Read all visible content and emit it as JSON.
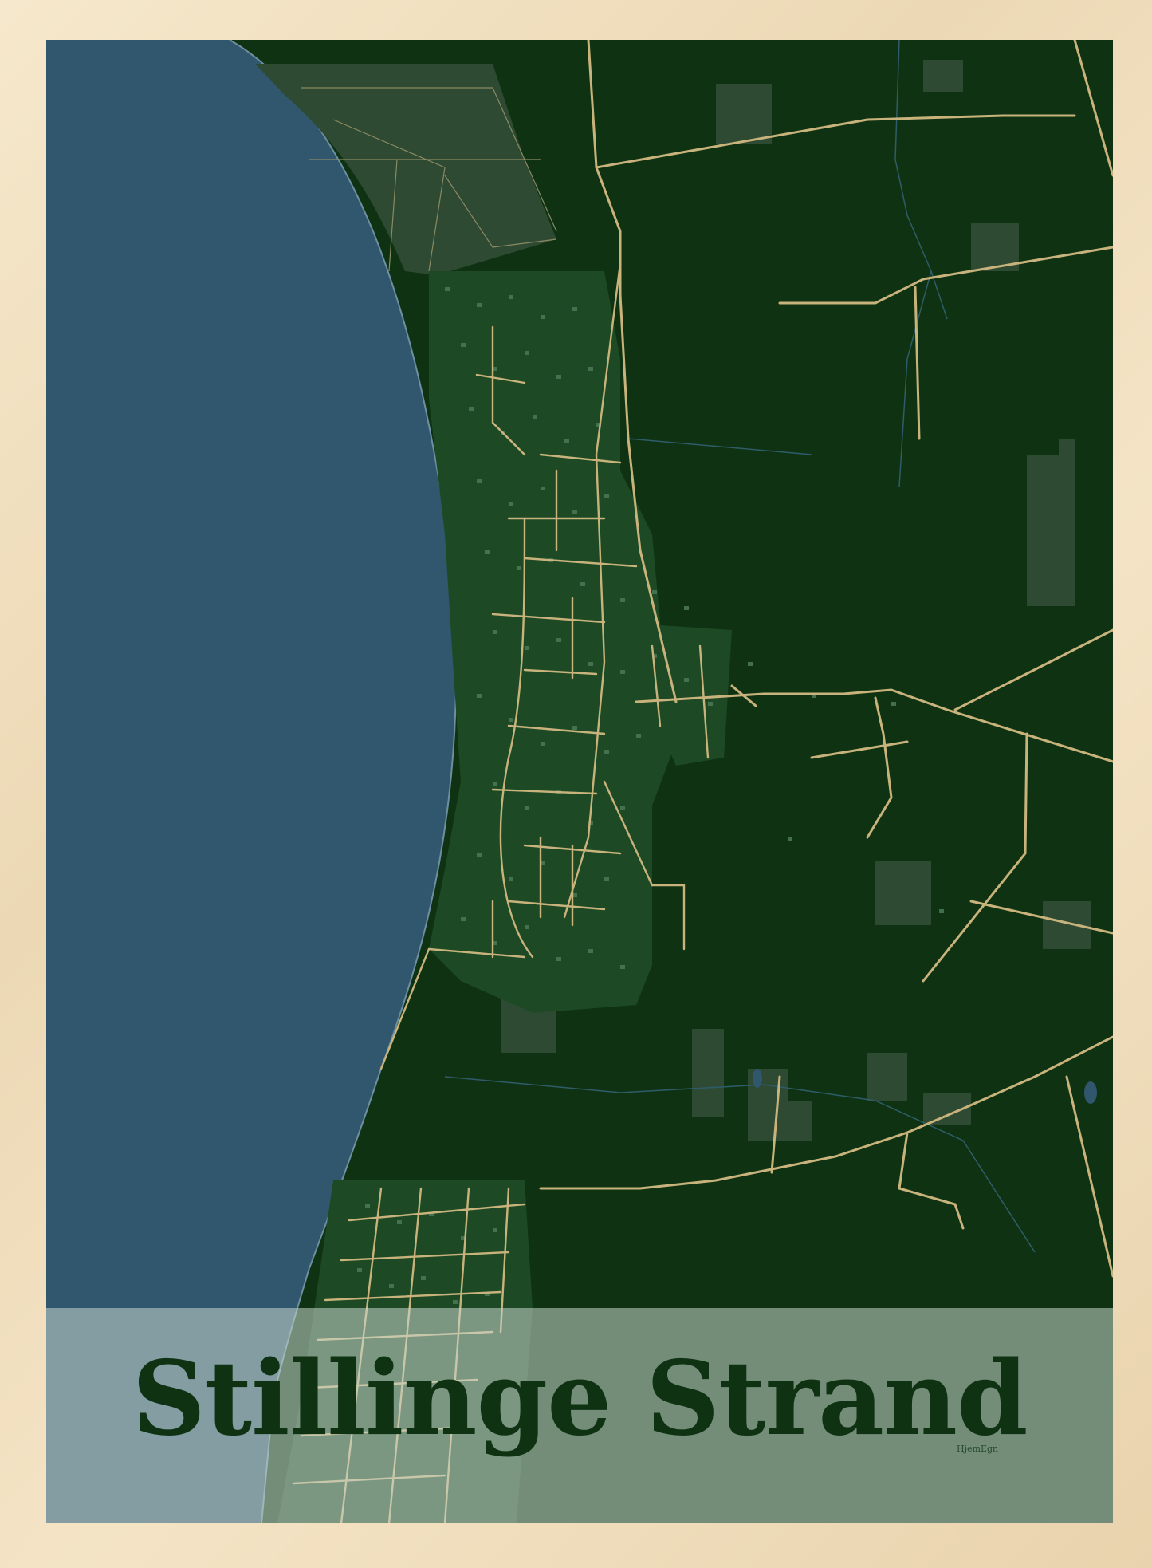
{
  "poster": {
    "title": "Stillinge Strand",
    "brand": "HjemEgn"
  },
  "colors": {
    "frame": "#f3e4c8",
    "land": "#0f3312",
    "sea": "#30576e",
    "roads": "#c9b37c",
    "buildings": "#4b7a58",
    "caption_band": "#c8d7cd",
    "title_text": "#0f3312"
  },
  "map": {
    "features": [
      "sea",
      "coastline",
      "town-grid",
      "main-roads",
      "farm-buildings",
      "park-area",
      "streams"
    ]
  }
}
